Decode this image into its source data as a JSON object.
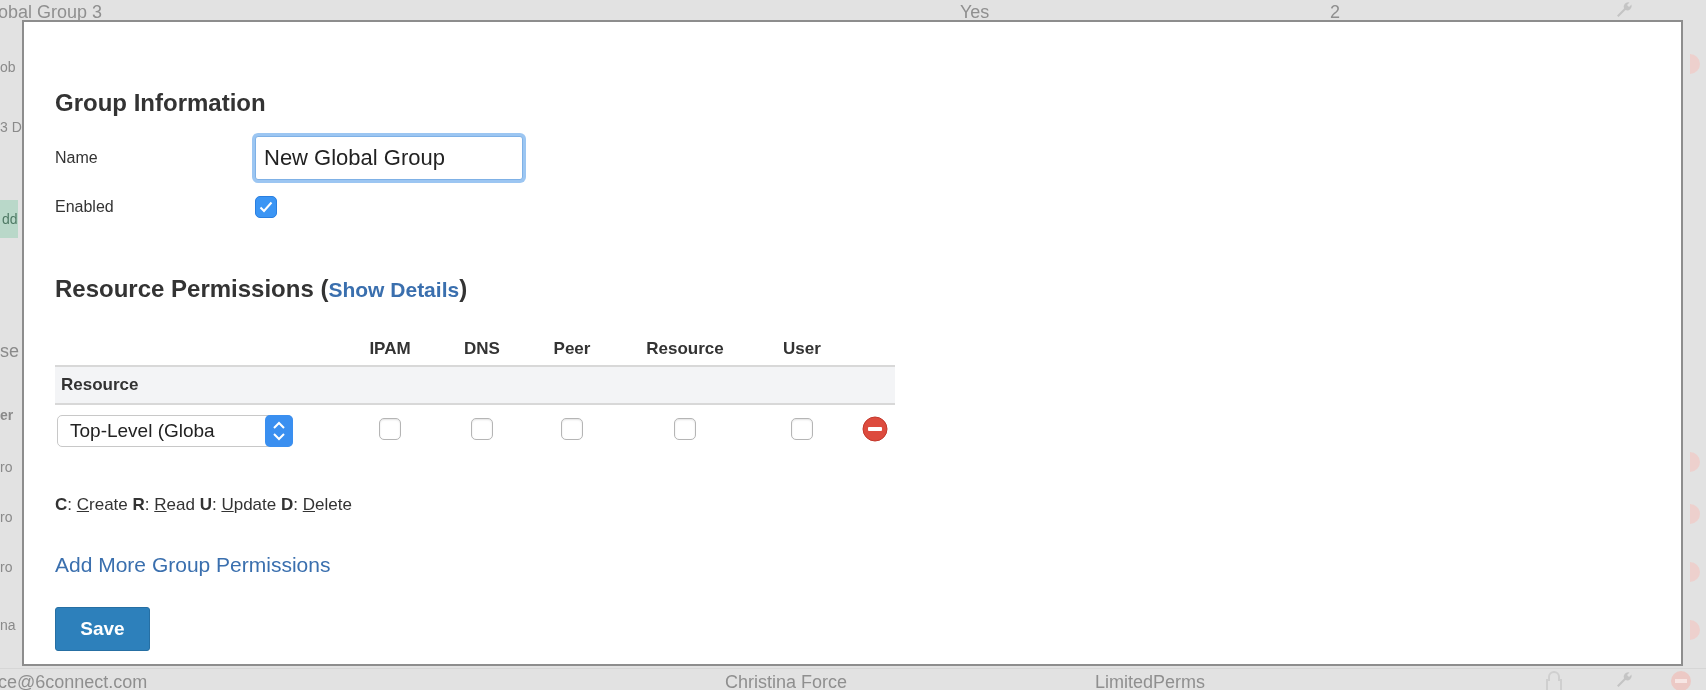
{
  "background": {
    "top_row": [
      "obal Group 3",
      "Yes",
      "2"
    ],
    "left_fragments": [
      {
        "kind": "text",
        "text": "ob"
      },
      {
        "kind": "text",
        "text": "3 D"
      },
      {
        "kind": "button",
        "text": "dd"
      },
      {
        "kind": "heading",
        "text": "se"
      },
      {
        "kind": "header",
        "text": "er"
      },
      {
        "kind": "text",
        "text": "ro"
      },
      {
        "kind": "text",
        "text": "ro"
      },
      {
        "kind": "text",
        "text": "ro"
      },
      {
        "kind": "text",
        "text": "na"
      }
    ],
    "bottom_row": [
      "ce@6connect.com",
      "Christina Force",
      "LimitedPerms"
    ]
  },
  "dialog": {
    "group_info": {
      "title": "Group Information",
      "name_label": "Name",
      "name_value": "New Global Group",
      "enabled_label": "Enabled",
      "enabled": true
    },
    "permissions": {
      "title_before": "Resource Permissions (",
      "link": "Show Details",
      "title_after": ")",
      "columns": [
        "IPAM",
        "DNS",
        "Peer",
        "Resource",
        "User"
      ],
      "group_header": "Resource",
      "rows": [
        {
          "resource": "Top-Level (Globa",
          "checks": [
            {
              "checked": false
            },
            {
              "checked": false
            },
            {
              "checked": false
            },
            {
              "checked": false
            },
            {
              "checked": false
            }
          ]
        }
      ]
    },
    "legend": [
      {
        "key": "C",
        "separator": ":",
        "word": "Create"
      },
      {
        "key": "R",
        "separator": ":",
        "word": "Read"
      },
      {
        "key": "U",
        "separator": ":",
        "word": "Update"
      },
      {
        "key": "D",
        "separator": ":",
        "word": "Delete"
      }
    ],
    "add_link": "Add More Group Permissions",
    "save_button": "Save"
  }
}
